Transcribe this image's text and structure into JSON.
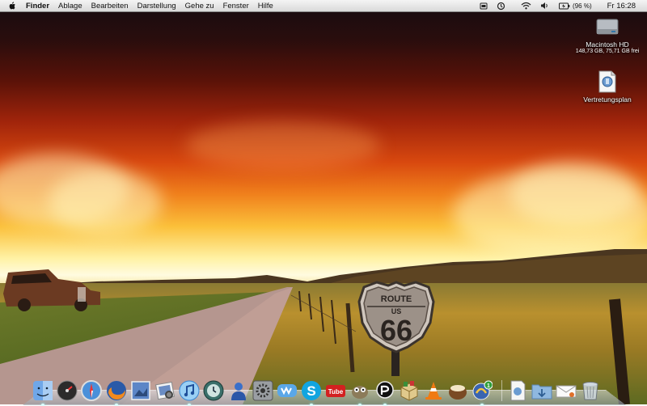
{
  "menubar": {
    "apple_icon": "apple-icon",
    "app_name": "Finder",
    "menus": [
      "Ablage",
      "Bearbeiten",
      "Darstellung",
      "Gehe zu",
      "Fenster",
      "Hilfe"
    ],
    "status": {
      "icons": [
        "battery-icon",
        "time-machine-icon",
        "wifi-icon",
        "volume-icon",
        "battery-charging-icon"
      ],
      "battery_text": "(96 %)",
      "clock": "Fr 16:28"
    }
  },
  "desktop": {
    "items": [
      {
        "label": "Macintosh HD",
        "sublabel": "148,73 GB, 75,71 GB frei",
        "icon": "hard-disk-icon"
      },
      {
        "label": "Vertretungsplan",
        "sublabel": "",
        "icon": "archive-file-icon"
      }
    ]
  },
  "wallpaper": {
    "sign_top": "ROUTE",
    "sign_mid": "US",
    "sign_number": "66"
  },
  "dock": {
    "apps": [
      "finder-icon",
      "dashboard-icon",
      "safari-icon",
      "firefox-icon",
      "preview-icon",
      "iphoto-icon",
      "itunes-icon",
      "time-machine-icon",
      "user-icon",
      "system-preferences-icon",
      "messenger-icon",
      "skype-icon",
      "youtube-icon",
      "gimp-icon",
      "pidgin-icon",
      "package-icon",
      "vlc-icon",
      "coconut-icon",
      "badge-app-icon"
    ],
    "youtube_text": "Tube",
    "badge_text": "1",
    "others": [
      "archive-stack-icon",
      "downloads-folder-icon",
      "mail-stack-icon",
      "trash-icon"
    ],
    "colors": {
      "accent": "#3b7ed6",
      "skype": "#12a5e0",
      "vlc": "#f07a12"
    }
  }
}
